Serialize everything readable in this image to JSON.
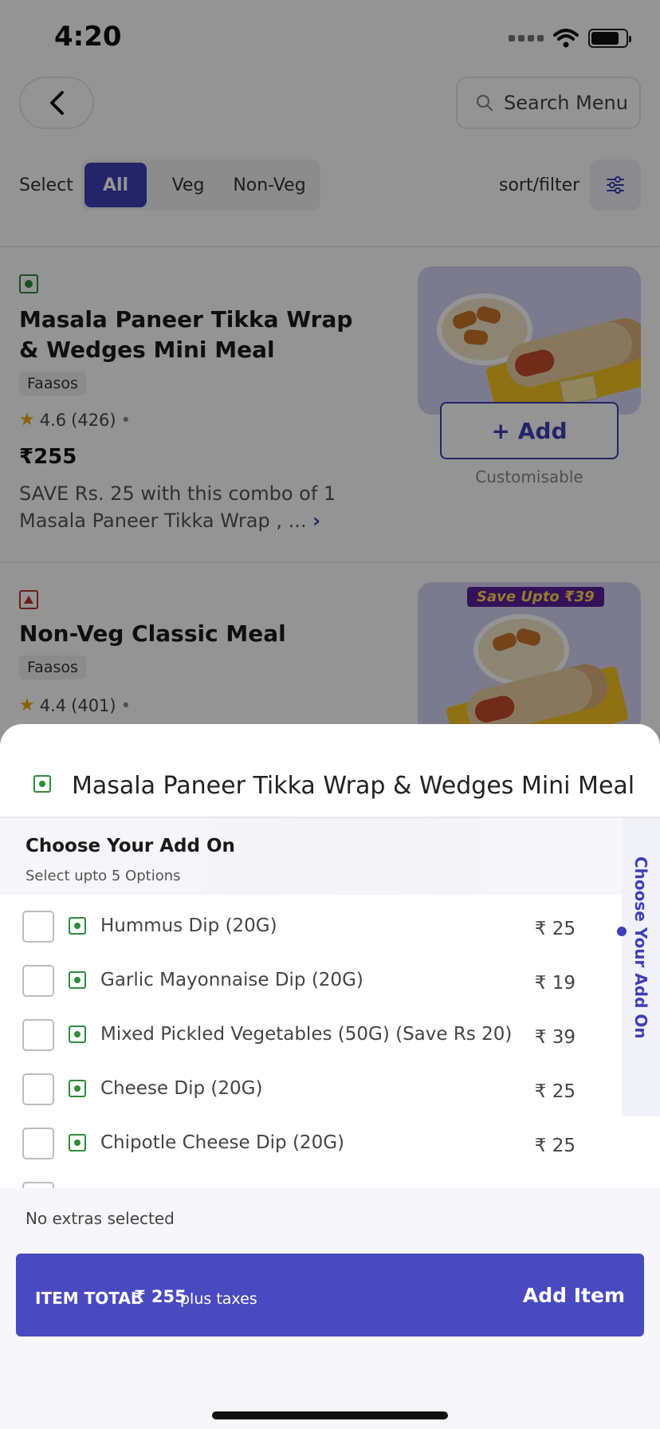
{
  "status": {
    "time": "4:20"
  },
  "header": {
    "search_placeholder": "Search Menu"
  },
  "filters": {
    "select_label": "Select",
    "options": [
      "All",
      "Veg",
      "Non-Veg"
    ],
    "selected": "All",
    "sort_label": "sort/filter"
  },
  "menu_items": [
    {
      "title": "Masala Paneer Tikka Wrap & Wedges Mini Meal",
      "brand": "Faasos",
      "rating": "4.6",
      "rating_count": "(426)",
      "price": "₹255",
      "description": "SAVE Rs. 25 with this combo of 1 Masala Paneer Tikka Wrap , ...",
      "add_label": "+ Add",
      "customisable": "Customisable",
      "diet": "veg"
    },
    {
      "title": "Non-Veg Classic Meal",
      "brand": "Faasos",
      "rating": "4.4",
      "rating_count": "(401)",
      "badge": "Save Upto ₹39",
      "diet": "non-veg"
    }
  ],
  "sheet": {
    "title": "Masala Paneer Tikka Wrap & Wedges Mini Meal",
    "section_title": "Choose Your Add On",
    "section_subtitle": "Select upto 5 Options",
    "side_rail_label": "Choose Your Add On",
    "addons": [
      {
        "name": "Hummus Dip (20G)",
        "price": "₹ 25"
      },
      {
        "name": "Garlic Mayonnaise Dip (20G)",
        "price": "₹ 19"
      },
      {
        "name": "Mixed Pickled Vegetables (50G) (Save Rs 20)",
        "price": "₹ 39"
      },
      {
        "name": "Cheese Dip (20G)",
        "price": "₹ 25"
      },
      {
        "name": "Chipotle Cheese Dip (20G)",
        "price": "₹ 25"
      }
    ],
    "extras_text": "No extras selected",
    "cta": {
      "total_label": "ITEM TOTAL",
      "amount": "₹ 255",
      "taxes": "plus taxes",
      "action": "Add Item"
    }
  },
  "colors": {
    "accent": "#3e3fb6",
    "cta": "#4a4ac0",
    "veg": "#2e8b3a",
    "non_veg": "#b3342e"
  }
}
